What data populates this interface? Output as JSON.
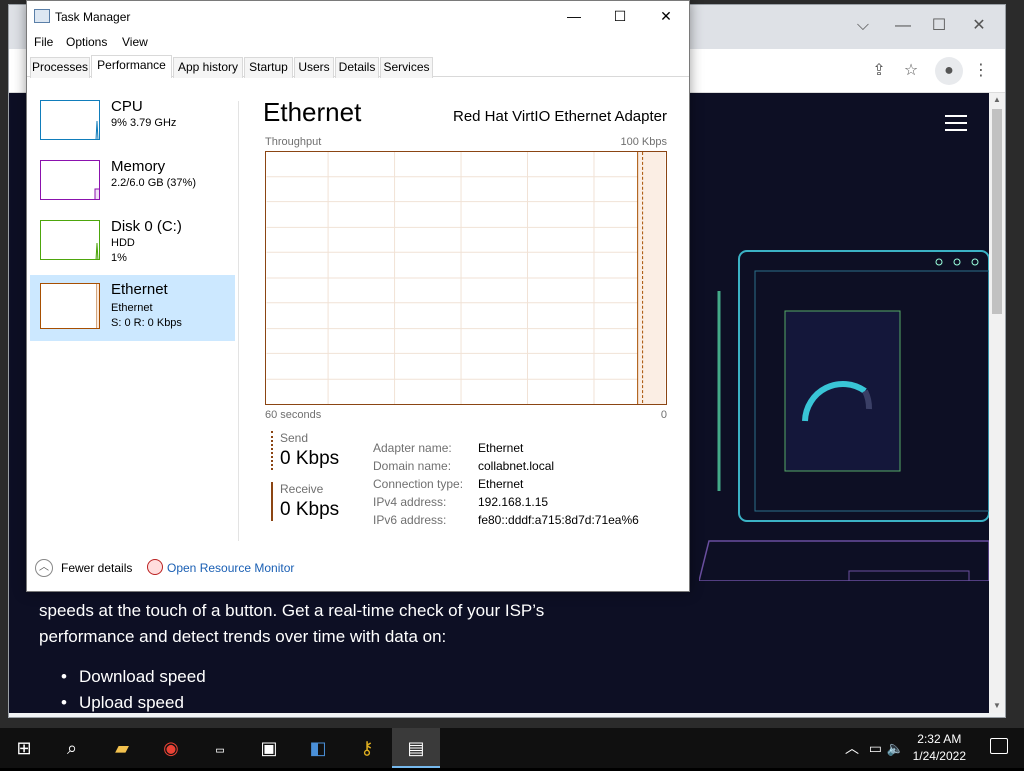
{
  "task_manager": {
    "title": "Task Manager",
    "menu": [
      "File",
      "Options",
      "View"
    ],
    "tabs": [
      "Processes",
      "Performance",
      "App history",
      "Startup",
      "Users",
      "Details",
      "Services"
    ],
    "active_tab": "Performance",
    "sidebar": [
      {
        "name": "CPU",
        "line1": "9%  3.79 GHz",
        "line2": "",
        "color": "#117dbb"
      },
      {
        "name": "Memory",
        "line1": "2.2/6.0 GB (37%)",
        "line2": "",
        "color": "#8b12ae"
      },
      {
        "name": "Disk 0 (C:)",
        "line1": "HDD",
        "line2": "1%",
        "color": "#4da60c"
      },
      {
        "name": "Ethernet",
        "line1": "Ethernet",
        "line2": "S: 0  R: 0 Kbps",
        "color": "#a74f01"
      }
    ],
    "detail": {
      "heading": "Ethernet",
      "adapter": "Red Hat VirtIO Ethernet Adapter",
      "graph_label": "Throughput",
      "graph_max": "100 Kbps",
      "graph_left": "60 seconds",
      "graph_right": "0",
      "send_label": "Send",
      "send_value": "0 Kbps",
      "receive_label": "Receive",
      "receive_value": "0 Kbps",
      "properties": [
        {
          "k": "Adapter name:",
          "v": "Ethernet"
        },
        {
          "k": "Domain name:",
          "v": "collabnet.local"
        },
        {
          "k": "Connection type:",
          "v": "Ethernet"
        },
        {
          "k": "IPv4 address:",
          "v": "192.168.1.15"
        },
        {
          "k": "IPv6 address:",
          "v": "fe80::dddf:a715:8d7d:71ea%6"
        }
      ]
    },
    "footer": {
      "fewer": "Fewer details",
      "monitor": "Open Resource Monitor"
    }
  },
  "browser": {
    "page_text": "speeds at the touch of a button. Get a real-time check of your ISP’s performance and detect trends over time with data on:",
    "bullets": [
      "Download speed",
      "Upload speed"
    ],
    "page_bg": "#0d0f24"
  },
  "taskbar": {
    "time": "2:32 AM",
    "date": "1/24/2022",
    "apps": [
      "file-explorer-icon",
      "chrome-icon",
      "cmd-icon",
      "network-icon",
      "remote-desktop-icon",
      "keys-icon",
      "task-manager-icon"
    ]
  }
}
